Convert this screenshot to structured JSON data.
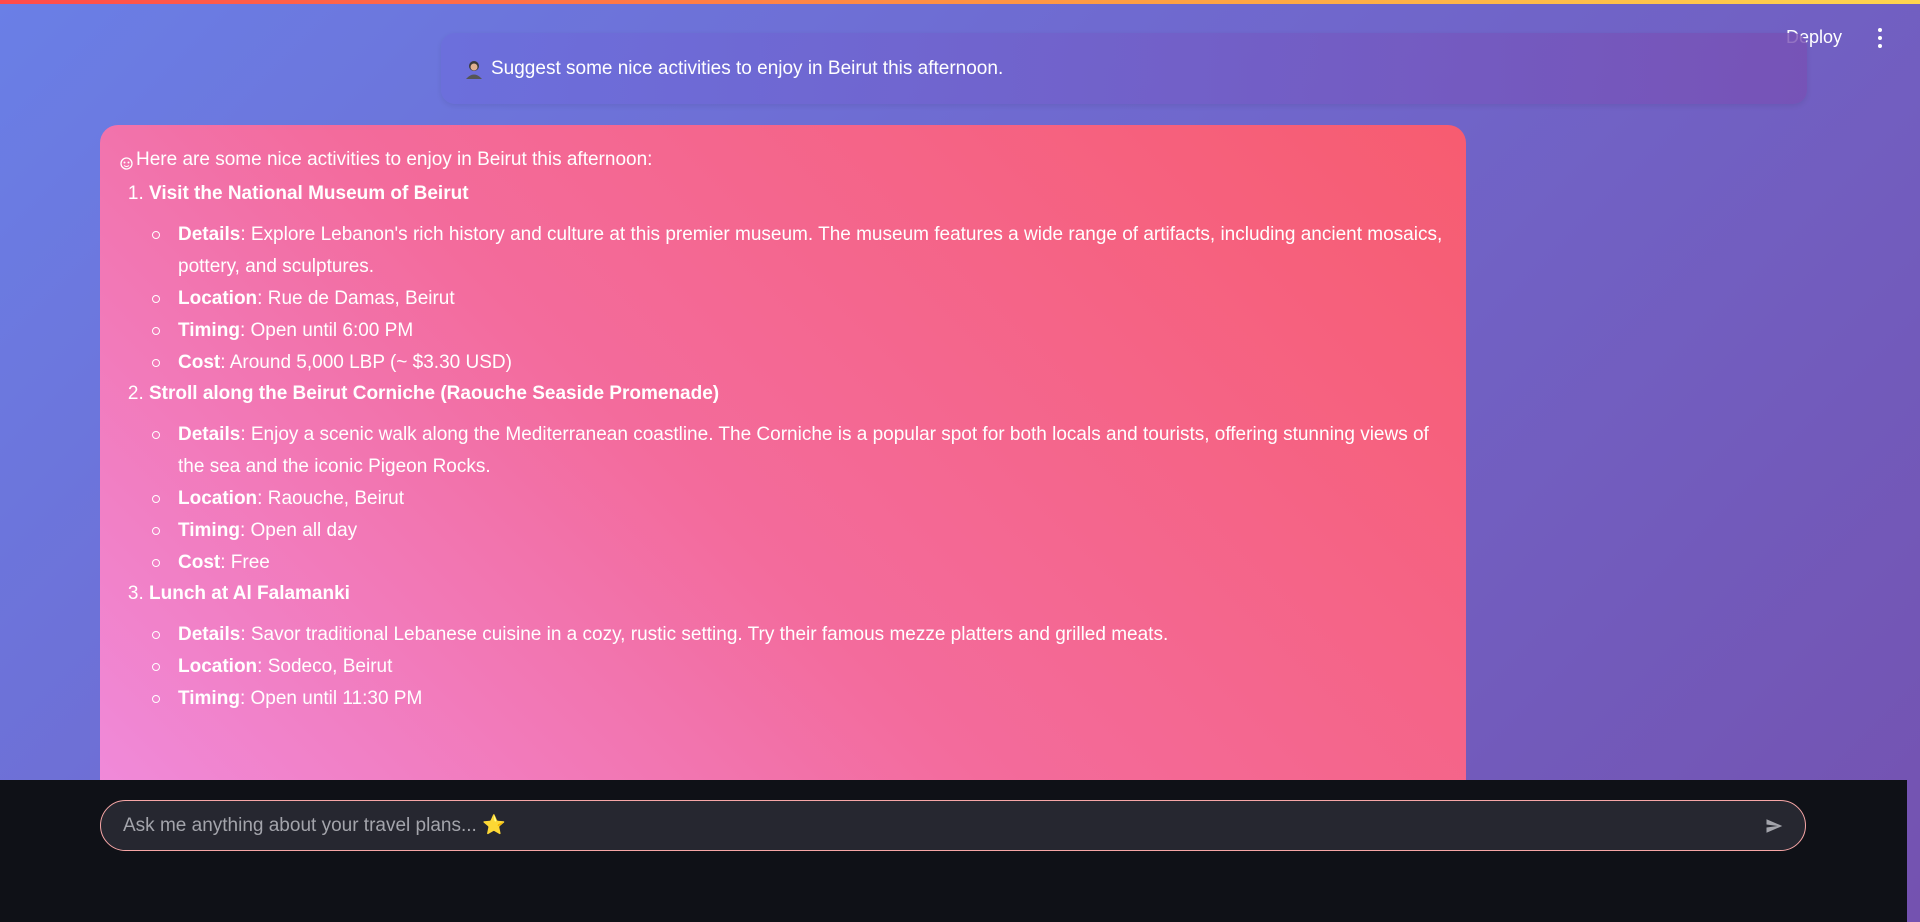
{
  "header": {
    "deploy_label": "Deploy",
    "menu_icon": "kebab-menu-icon"
  },
  "user_message": {
    "avatar_icon": "user-avatar-icon",
    "text": "Suggest some nice activities to enjoy in Beirut this afternoon."
  },
  "assistant_message": {
    "icon": "assistant-avatar-icon",
    "intro": "Here are some nice activities to enjoy in Beirut this afternoon:",
    "activities": [
      {
        "title": "Visit the National Museum of Beirut",
        "details": [
          {
            "label": "Details",
            "text": ": Explore Lebanon's rich history and culture at this premier museum. The museum features a wide range of artifacts, including ancient mosaics, pottery, and sculptures."
          },
          {
            "label": "Location",
            "text": ": Rue de Damas, Beirut"
          },
          {
            "label": "Timing",
            "text": ": Open until 6:00 PM"
          },
          {
            "label": "Cost",
            "text": ": Around 5,000 LBP (~ $3.30 USD)"
          }
        ]
      },
      {
        "title": "Stroll along the Beirut Corniche (Raouche Seaside Promenade)",
        "details": [
          {
            "label": "Details",
            "text": ": Enjoy a scenic walk along the Mediterranean coastline. The Corniche is a popular spot for both locals and tourists, offering stunning views of the sea and the iconic Pigeon Rocks."
          },
          {
            "label": "Location",
            "text": ": Raouche, Beirut"
          },
          {
            "label": "Timing",
            "text": ": Open all day"
          },
          {
            "label": "Cost",
            "text": ": Free"
          }
        ]
      },
      {
        "title": "Lunch at Al Falamanki",
        "details": [
          {
            "label": "Details",
            "text": ": Savor traditional Lebanese cuisine in a cozy, rustic setting. Try their famous mezze platters and grilled meats."
          },
          {
            "label": "Location",
            "text": ": Sodeco, Beirut"
          },
          {
            "label": "Timing",
            "text": ": Open until 11:30 PM"
          }
        ]
      }
    ]
  },
  "chat_input": {
    "placeholder": "Ask me anything about your travel plans... ⭐",
    "send_icon": "send-icon"
  },
  "colors": {
    "accent_strip": "#ff4b4b",
    "input_border": "#f7a6a6",
    "bottom_bg": "#0f1117"
  }
}
